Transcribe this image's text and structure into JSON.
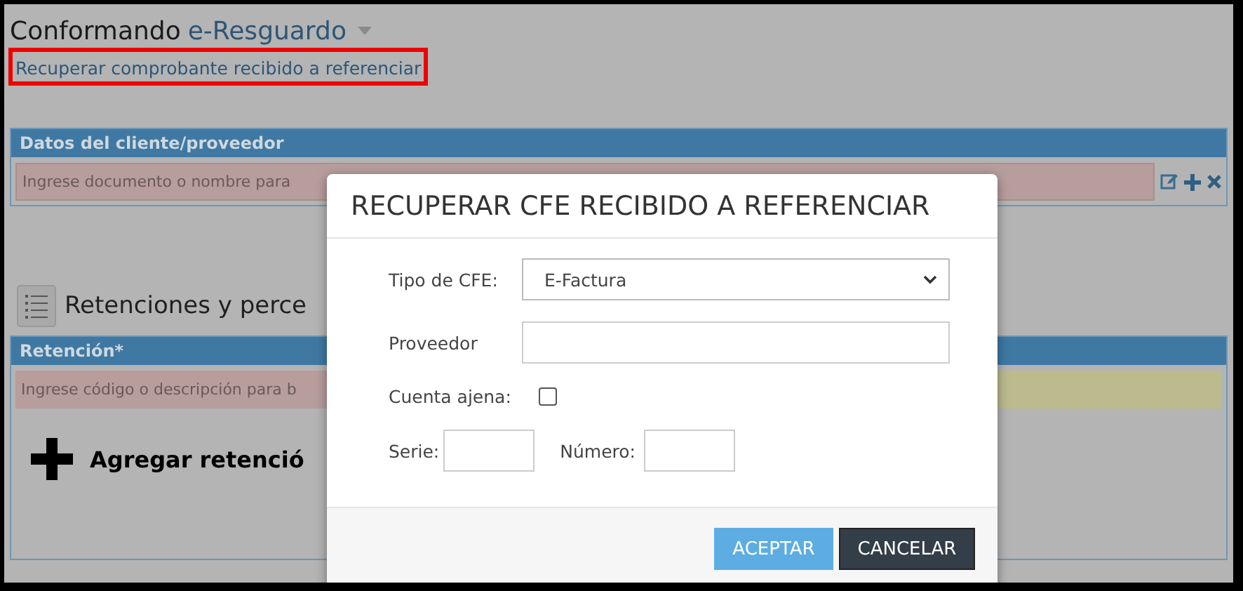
{
  "page": {
    "title": "Conformando",
    "title_link": "e-Resguardo",
    "highlighted_link": "Recuperar comprobante recibido a referenciar"
  },
  "client_panel": {
    "header": "Datos del cliente/proveedor",
    "placeholder": "Ingrese documento o nombre para"
  },
  "section": {
    "title": "Retenciones y perce"
  },
  "retention_panel": {
    "header": "Retención*",
    "placeholder": "Ingrese código o descripción para b",
    "add_label": "Agregar retenció"
  },
  "dialog": {
    "title": "RECUPERAR CFE RECIBIDO A REFERENCIAR",
    "cfe_type": {
      "label": "Tipo de CFE:",
      "value": "E-Factura"
    },
    "supplier": {
      "label": "Proveedor"
    },
    "third_party": {
      "label": "Cuenta ajena:",
      "checked": false
    },
    "series": {
      "label": "Serie:"
    },
    "number": {
      "label": "Número:"
    },
    "buttons": [
      {
        "label": "ACEPTAR",
        "kind": "primary"
      },
      {
        "label": "CANCELAR",
        "kind": "secondary"
      }
    ]
  }
}
